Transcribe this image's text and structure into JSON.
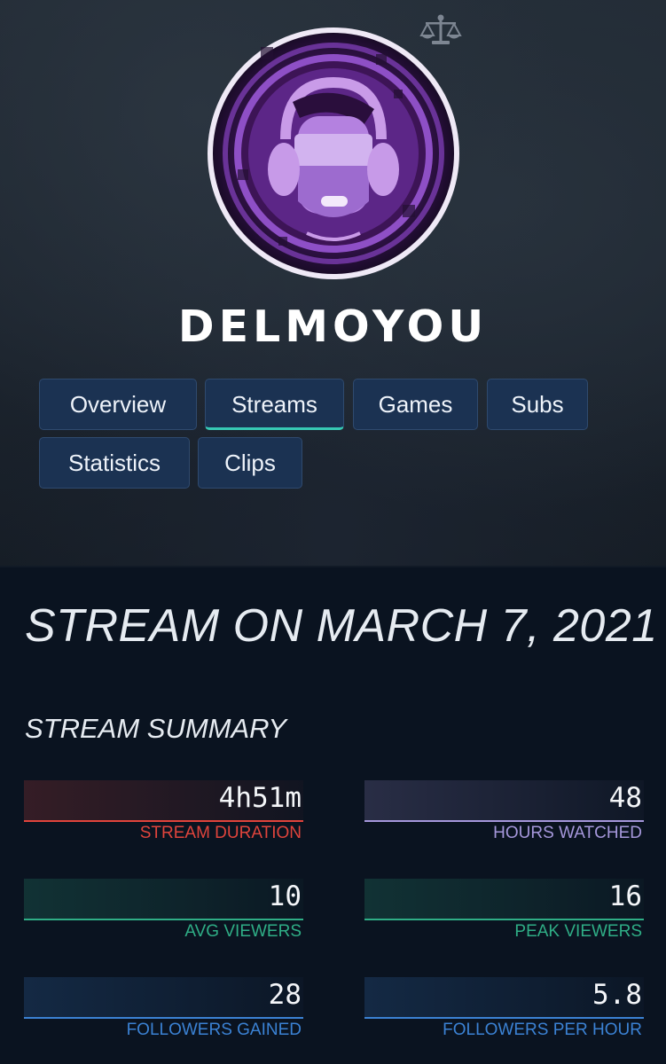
{
  "channel": {
    "name": "DELMOYOU",
    "avatar_icon": "headphones-avatar-icon",
    "badge_icon": "scale-icon"
  },
  "tabs": [
    {
      "label": "Overview",
      "active": false
    },
    {
      "label": "Streams",
      "active": true
    },
    {
      "label": "Games",
      "active": false
    },
    {
      "label": "Subs",
      "active": false
    },
    {
      "label": "Statistics",
      "active": false
    },
    {
      "label": "Clips",
      "active": false
    }
  ],
  "page": {
    "title": "STREAM ON MARCH 7, 2021",
    "summary_heading": "STREAM SUMMARY"
  },
  "stats": [
    {
      "value": "4h51m",
      "label": "STREAM DURATION",
      "color": "#e0443c"
    },
    {
      "value": "48",
      "label": "HOURS WATCHED",
      "color": "#a597db"
    },
    {
      "value": "10",
      "label": "AVG VIEWERS",
      "color": "#2fae86"
    },
    {
      "value": "16",
      "label": "PEAK VIEWERS",
      "color": "#2fae86"
    },
    {
      "value": "28",
      "label": "FOLLOWERS GAINED",
      "color": "#3b82d4"
    },
    {
      "value": "5.8",
      "label": "FOLLOWERS PER HOUR",
      "color": "#3b82d4"
    }
  ],
  "colors": {
    "background": "#0a1320",
    "tab_background": "#1b3252",
    "tab_active_underline": "#37c8b4",
    "avatar_purple": "#8e4fc6"
  }
}
